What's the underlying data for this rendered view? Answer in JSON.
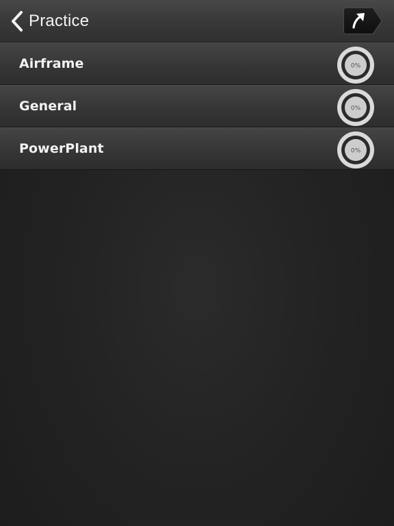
{
  "navbar": {
    "back_icon": "chevron-left-icon",
    "title": "Practice",
    "share_icon": "arrow-up-right-icon"
  },
  "categories": [
    {
      "label": "Airframe",
      "progress_text": "0%",
      "progress": 0
    },
    {
      "label": "General",
      "progress_text": "0%",
      "progress": 0
    },
    {
      "label": "PowerPlant",
      "progress_text": "0%",
      "progress": 0
    }
  ],
  "colors": {
    "ring_outer": "#d9d9d9",
    "ring_track": "#2a2a2a",
    "ring_inner": "#cfcfcf"
  }
}
